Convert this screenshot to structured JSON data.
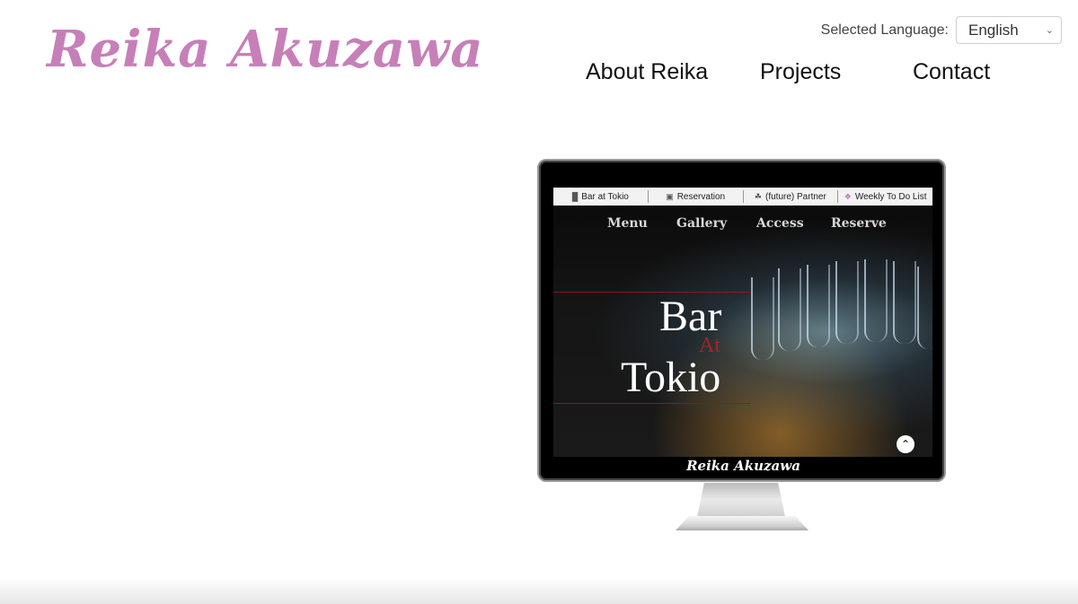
{
  "brand": {
    "name": "Reika Akuzawa",
    "color": "#c77fb8"
  },
  "language": {
    "label": "Selected Language:",
    "selected": "English"
  },
  "nav": {
    "about": "About Reika",
    "projects": "Projects",
    "contact": "Contact"
  },
  "monitor": {
    "tabs": [
      {
        "icon": "bar-icon",
        "label": "Bar at Tokio"
      },
      {
        "icon": "calendar-icon",
        "label": "Reservation"
      },
      {
        "icon": "leaf-icon",
        "label": "(future) Partner"
      },
      {
        "icon": "cubes-icon",
        "label": "Weekly To Do List"
      }
    ],
    "site_nav": [
      "Menu",
      "Gallery",
      "Access",
      "Reserve"
    ],
    "hero": {
      "line1": "Bar",
      "line2": "At",
      "line3": "Tokio"
    },
    "footer": "Reika Akuzawa"
  }
}
